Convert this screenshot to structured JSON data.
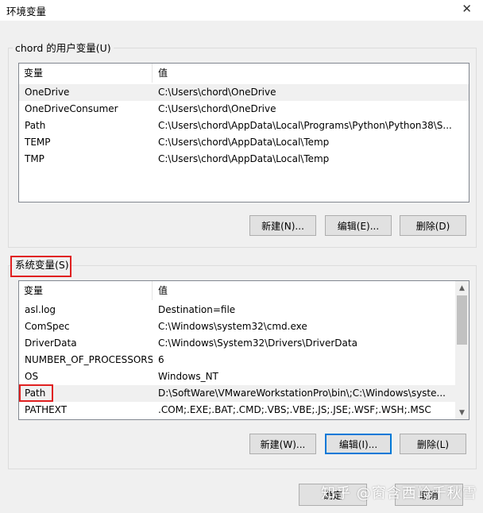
{
  "window": {
    "title": "环境变量",
    "close_glyph": "✕"
  },
  "user_vars": {
    "group_label": "chord 的用户变量(U)",
    "header": {
      "name": "变量",
      "value": "值"
    },
    "rows": [
      {
        "name": "OneDrive",
        "value": "C:\\Users\\chord\\OneDrive"
      },
      {
        "name": "OneDriveConsumer",
        "value": "C:\\Users\\chord\\OneDrive"
      },
      {
        "name": "Path",
        "value": "C:\\Users\\chord\\AppData\\Local\\Programs\\Python\\Python38\\S..."
      },
      {
        "name": "TEMP",
        "value": "C:\\Users\\chord\\AppData\\Local\\Temp"
      },
      {
        "name": "TMP",
        "value": "C:\\Users\\chord\\AppData\\Local\\Temp"
      }
    ],
    "buttons": {
      "new": "新建(N)...",
      "edit": "编辑(E)...",
      "delete": "删除(D)"
    }
  },
  "system_vars": {
    "group_label": "系统变量(S)",
    "header": {
      "name": "变量",
      "value": "值"
    },
    "rows": [
      {
        "name": "asl.log",
        "value": "Destination=file"
      },
      {
        "name": "ComSpec",
        "value": "C:\\Windows\\system32\\cmd.exe"
      },
      {
        "name": "DriverData",
        "value": "C:\\Windows\\System32\\Drivers\\DriverData"
      },
      {
        "name": "NUMBER_OF_PROCESSORS",
        "value": "6"
      },
      {
        "name": "OS",
        "value": "Windows_NT"
      },
      {
        "name": "Path",
        "value": "D:\\SoftWare\\VMwareWorkstationPro\\bin\\;C:\\Windows\\syste..."
      },
      {
        "name": "PATHEXT",
        "value": ".COM;.EXE;.BAT;.CMD;.VBS;.VBE;.JS;.JSE;.WSF;.WSH;.MSC"
      }
    ],
    "buttons": {
      "new": "新建(W)...",
      "edit": "编辑(I)...",
      "delete": "删除(L)"
    }
  },
  "dialog_buttons": {
    "ok": "确定",
    "cancel": "取消"
  },
  "watermark": "知乎 @窗含西岭千秋雪",
  "colors": {
    "highlight_box": "#e02020",
    "focus_border": "#0078d7"
  },
  "icons": {
    "scroll_up": "chevron-up-icon",
    "scroll_down": "chevron-down-icon",
    "close": "close-icon"
  }
}
